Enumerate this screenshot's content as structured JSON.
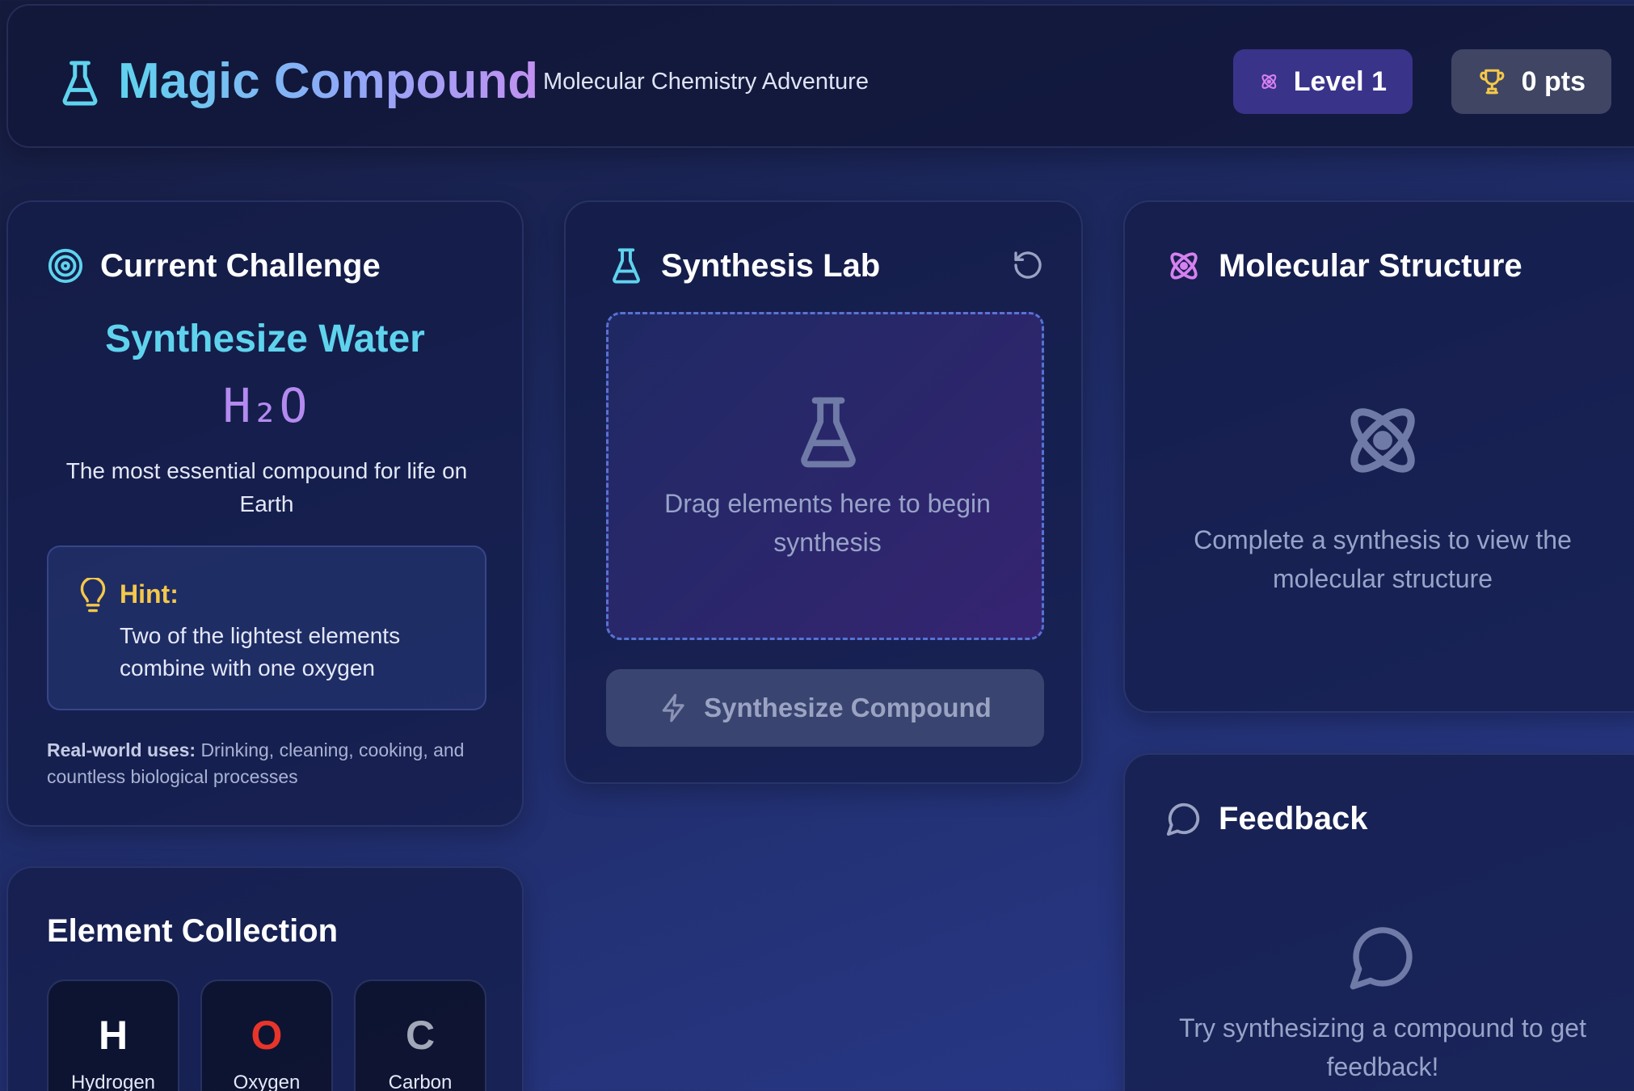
{
  "header": {
    "title": "Magic Compound",
    "subtitle": "Molecular Chemistry Adventure",
    "level": "Level 1",
    "points": "0 pts"
  },
  "challenge": {
    "heading": "Current Challenge",
    "name": "Synthesize Water",
    "formula": "H₂O",
    "description": "The most essential compound for life on Earth",
    "hint_label": "Hint:",
    "hint_text": "Two of the lightest elements combine with one oxygen",
    "uses_label": "Real-world uses:",
    "uses_text": "Drinking, cleaning, cooking, and countless biological processes"
  },
  "elements": {
    "heading": "Element Collection",
    "items": [
      {
        "symbol": "H",
        "name": "Hydrogen",
        "color": "#ffffff"
      },
      {
        "symbol": "O",
        "name": "Oxygen",
        "color": "#e8352a"
      },
      {
        "symbol": "C",
        "name": "Carbon",
        "color": "#a3a8b8"
      }
    ]
  },
  "lab": {
    "heading": "Synthesis Lab",
    "dropzone_text": "Drag elements here to begin synthesis",
    "synthesize_label": "Synthesize Compound"
  },
  "molecule": {
    "heading": "Molecular Structure",
    "placeholder": "Complete a synthesis to view the molecular structure"
  },
  "feedback": {
    "heading": "Feedback",
    "placeholder": "Try synthesizing a compound to get feedback!"
  },
  "colors": {
    "accent_cyan": "#5fd3ee",
    "accent_purple": "#b48af0",
    "hint_yellow": "#f5c84a",
    "atom_pink": "#d780f0"
  },
  "icons": {
    "brand": "flask-icon",
    "level": "atom-icon",
    "points": "trophy-icon",
    "challenge": "target-icon",
    "hint": "lightbulb-icon",
    "lab": "flask-icon",
    "reset": "rotate-ccw-icon",
    "synthesize": "zap-icon",
    "molecule": "atom-icon",
    "feedback": "message-circle-icon"
  }
}
